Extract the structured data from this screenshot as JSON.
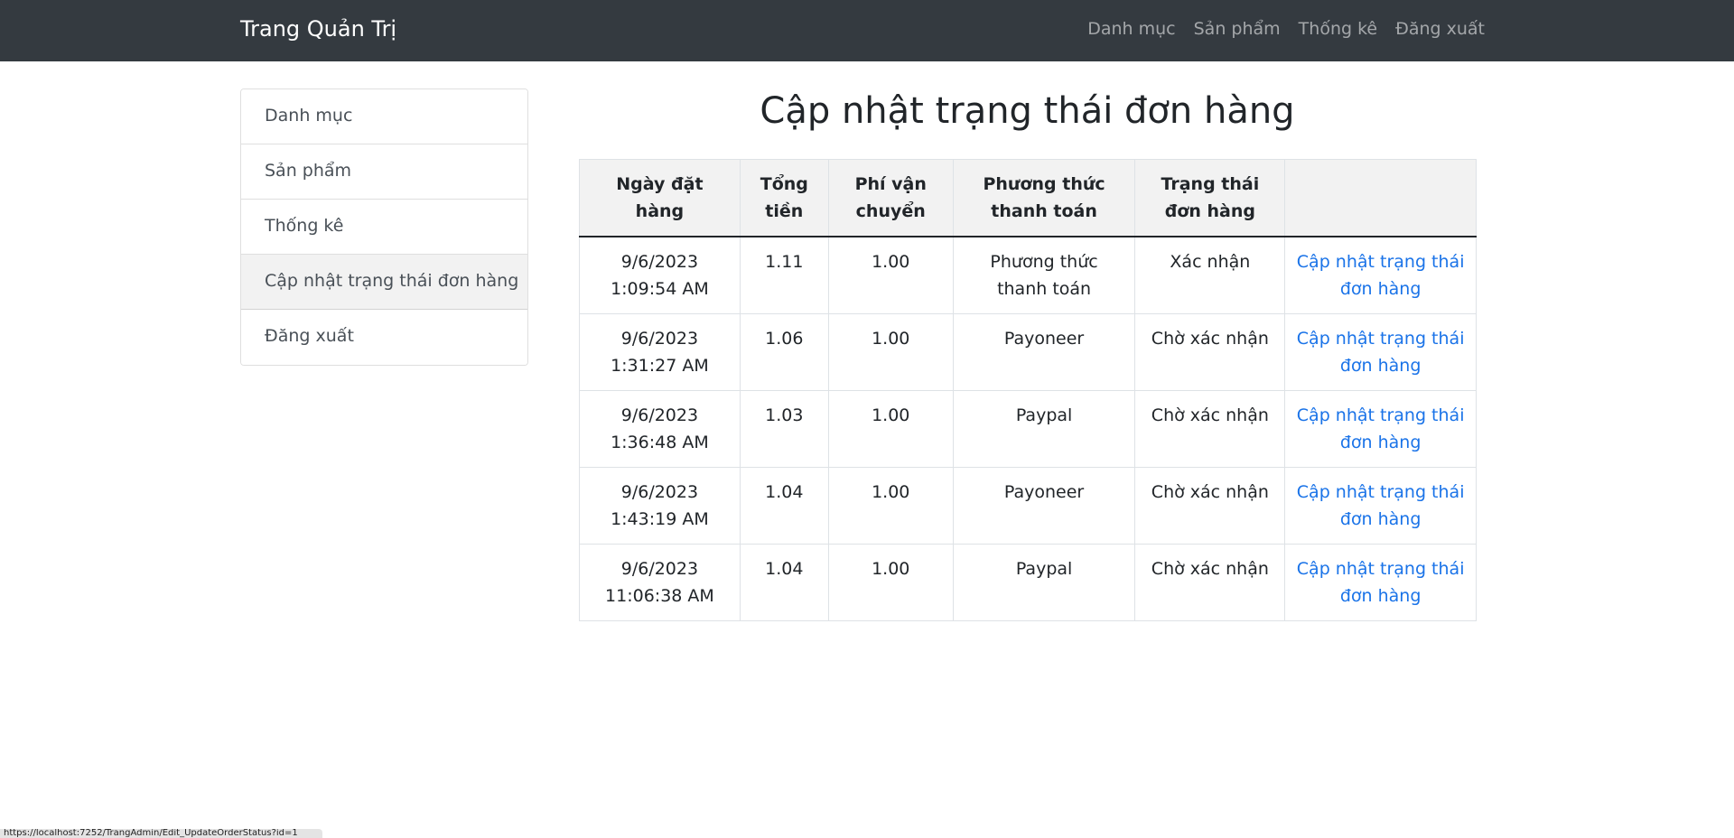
{
  "navbar": {
    "brand": "Trang Quản Trị",
    "links": [
      "Danh mục",
      "Sản phẩm",
      "Thống kê",
      "Đăng xuất"
    ]
  },
  "sidebar": {
    "items": [
      {
        "label": "Danh mục"
      },
      {
        "label": "Sản phẩm"
      },
      {
        "label": "Thống kê"
      },
      {
        "label": "Cập nhật trạng thái đơn hàng",
        "active": true
      },
      {
        "label": "Đăng xuất"
      }
    ]
  },
  "main": {
    "title": "Cập nhật trạng thái đơn hàng",
    "table": {
      "headers": [
        "Ngày đặt hàng",
        "Tổng tiền",
        "Phí vận chuyển",
        "Phương thức thanh toán",
        "Trạng thái đơn hàng",
        ""
      ],
      "rows": [
        {
          "date": "9/6/2023 1:09:54 AM",
          "total": "1.11",
          "shipping": "1.00",
          "payment": "Phương thức thanh toán",
          "status": "Xác nhận",
          "action": "Cập nhật trạng thái đơn hàng"
        },
        {
          "date": "9/6/2023 1:31:27 AM",
          "total": "1.06",
          "shipping": "1.00",
          "payment": "Payoneer",
          "status": "Chờ xác nhận",
          "action": "Cập nhật trạng thái đơn hàng"
        },
        {
          "date": "9/6/2023 1:36:48 AM",
          "total": "1.03",
          "shipping": "1.00",
          "payment": "Paypal",
          "status": "Chờ xác nhận",
          "action": "Cập nhật trạng thái đơn hàng"
        },
        {
          "date": "9/6/2023 1:43:19 AM",
          "total": "1.04",
          "shipping": "1.00",
          "payment": "Payoneer",
          "status": "Chờ xác nhận",
          "action": "Cập nhật trạng thái đơn hàng"
        },
        {
          "date": "9/6/2023 11:06:38 AM",
          "total": "1.04",
          "shipping": "1.00",
          "payment": "Paypal",
          "status": "Chờ xác nhận",
          "action": "Cập nhật trạng thái đơn hàng"
        }
      ]
    }
  },
  "statusbar": {
    "url": "https://localhost:7252/TrangAdmin/Edit_UpdateOrderStatus?id=1"
  },
  "colors": {
    "navbar_bg": "#343a40",
    "link": "#1a73e8",
    "active_item_bg": "#f2f2f2"
  }
}
